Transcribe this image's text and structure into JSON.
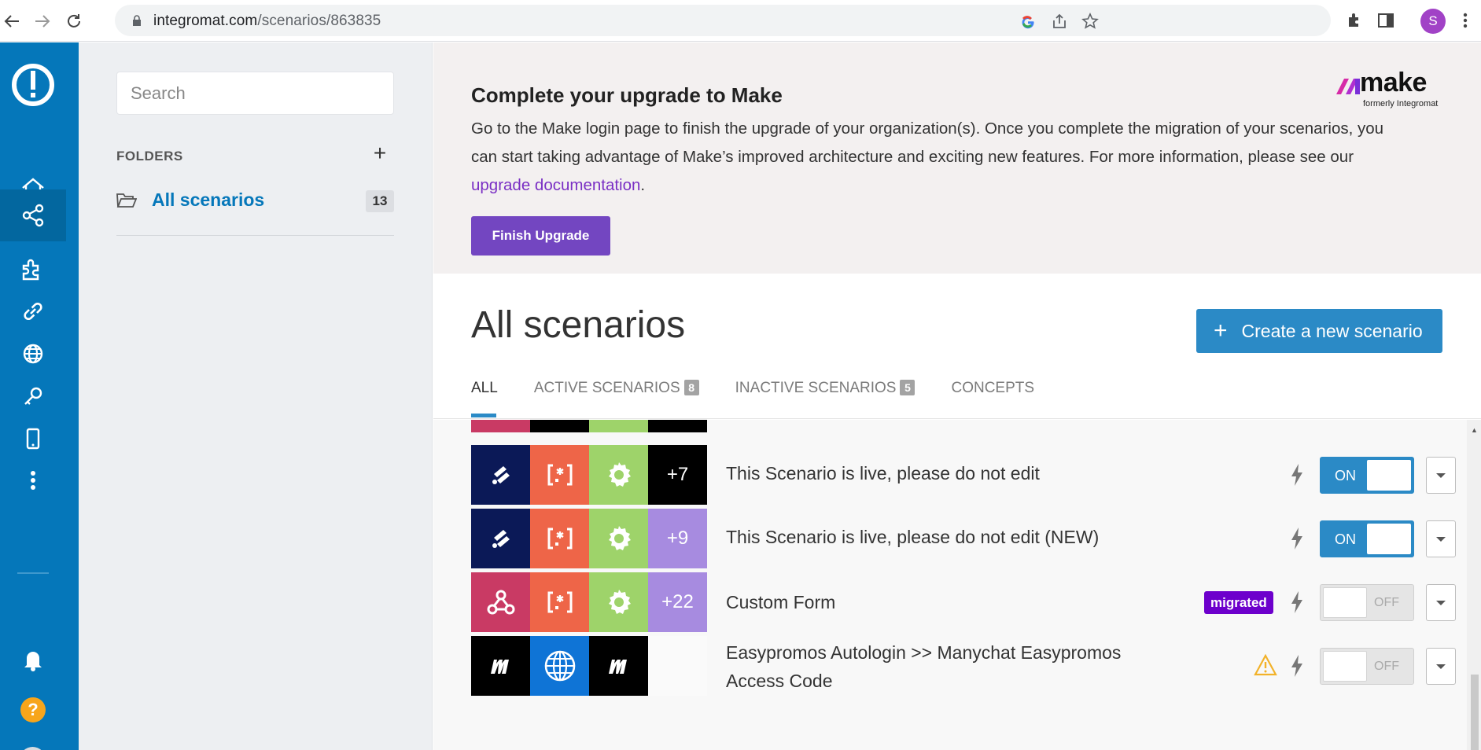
{
  "browser": {
    "url_host": "integromat.com",
    "url_path": "/scenarios/863835",
    "profile_initial": "S"
  },
  "sidebar": {
    "search_placeholder": "Search",
    "folders_heading": "FOLDERS",
    "add_label": "+",
    "folder": {
      "name": "All scenarios",
      "count": "13"
    }
  },
  "banner": {
    "title": "Complete your upgrade to Make",
    "body_text": "Go to the Make login page to finish the upgrade of your organization(s). Once you complete the migration of your scenarios, you can start taking advantage of Make’s improved architecture and exciting new features.  For more information, please see our ",
    "link_text": "upgrade documentation",
    "body_end": ".",
    "button_label": "Finish Upgrade",
    "logo_word": "make",
    "logo_sub": "formerly Integromat",
    "colors": {
      "background": "#f3f0f0",
      "button": "#7346c1",
      "link": "#7a2fc4"
    }
  },
  "main": {
    "title": "All scenarios",
    "create_label": "Create a new scenario",
    "tabs": [
      {
        "label": "ALL",
        "badge": ""
      },
      {
        "label": "ACTIVE SCENARIOS",
        "badge": "8"
      },
      {
        "label": "INACTIVE SCENARIOS",
        "badge": "5"
      },
      {
        "label": "CONCEPTS",
        "badge": ""
      }
    ]
  },
  "scenarios": [
    {
      "name": "This Scenario is live, please do not edit",
      "more": "+7",
      "status": "ON",
      "tiles": [
        "app-logo-icon",
        "regex-icon",
        "gear-icon",
        "more"
      ],
      "tile_colors": [
        "#0b1957",
        "#ee6548",
        "#9ed36a",
        "#000000"
      ]
    },
    {
      "name": "This Scenario is live, please do not edit (NEW)",
      "more": "+9",
      "status": "ON",
      "tiles": [
        "app-logo-icon",
        "regex-icon",
        "gear-icon",
        "more"
      ],
      "tile_colors": [
        "#0b1957",
        "#ee6548",
        "#9ed36a",
        "#a78be0"
      ]
    },
    {
      "name": "Custom Form",
      "more": "+22",
      "status": "OFF",
      "badge": "migrated",
      "tiles": [
        "webhook-icon",
        "regex-icon",
        "gear-icon",
        "more"
      ],
      "tile_colors": [
        "#c93a64",
        "#ee6548",
        "#9ed36a",
        "#a78be0"
      ]
    },
    {
      "name": "Easypromos Autologin >> Manychat Easypromos Access Code",
      "status": "OFF",
      "warning": true,
      "tiles": [
        "manychat-icon",
        "globe-icon",
        "manychat-icon"
      ],
      "tile_colors": [
        "#000000",
        "#0f74d6",
        "#000000"
      ]
    }
  ]
}
